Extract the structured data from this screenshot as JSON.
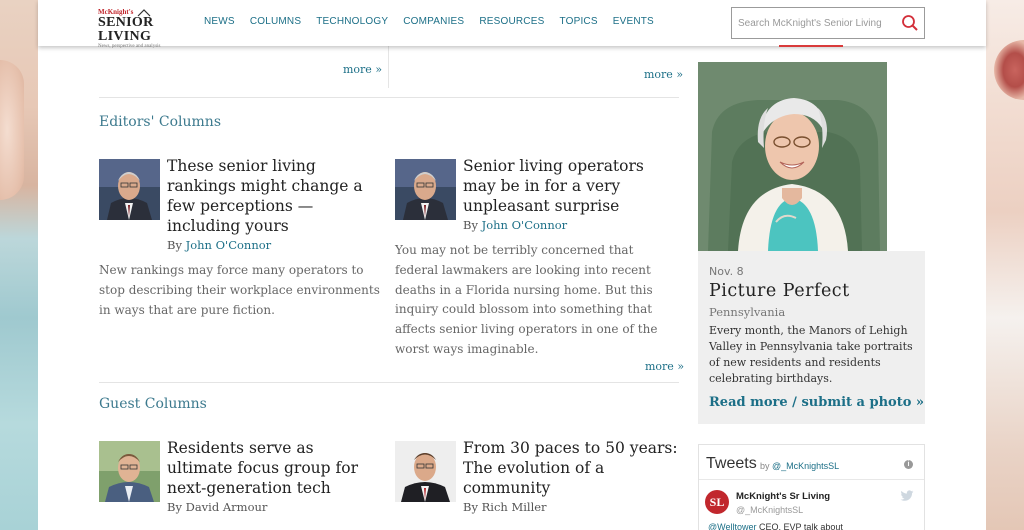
{
  "logo": {
    "line1": "McKnight's",
    "line2": "SENIOR LIVING",
    "tagline": "News, perspective and analysis"
  },
  "nav": [
    "NEWS",
    "COLUMNS",
    "TECHNOLOGY",
    "COMPANIES",
    "RESOURCES",
    "TOPICS",
    "EVENTS"
  ],
  "search": {
    "placeholder": "Search McKnight's Senior Living",
    "icon": "search-icon"
  },
  "top_more": {
    "left": "more »",
    "right": "more »"
  },
  "editors": {
    "title": "Editors' Columns",
    "articles": [
      {
        "title": "These senior living rankings might change a few perceptions — including yours",
        "by": "By ",
        "author": "John O'Connor",
        "excerpt": "New rankings may force many operators to stop describing their workplace environments in ways that are pure fiction."
      },
      {
        "title": "Senior living operators may be in for a very unpleasant surprise",
        "by": "By ",
        "author": "John O'Connor",
        "excerpt": "You may not be terribly concerned that federal lawmakers are looking into recent deaths in a Florida nursing home. But this inquiry could blossom into something that affects senior living operators in one of the worst ways imaginable."
      }
    ],
    "more": "more »"
  },
  "guest": {
    "title": "Guest Columns",
    "articles": [
      {
        "title": "Residents serve as ultimate focus group for next-generation tech",
        "by": "By David Armour"
      },
      {
        "title": "From 30 paces to 50 years: The evolution of a community",
        "by": "By Rich Miller"
      }
    ]
  },
  "picture_perfect": {
    "date": "Nov. 8",
    "title": "Picture Perfect",
    "location": "Pennsylvania",
    "description": "Every month, the Manors of Lehigh Valley in Pennsylvania take portraits of new residents and residents celebrating birthdays.",
    "link": "Read more / submit a photo »"
  },
  "tweets": {
    "heading": "Tweets",
    "by_prefix": "by ",
    "by_handle": "@_McKnightsSL",
    "info": "i",
    "account_name": "McKnight's Sr Living",
    "account_handle": "@_McKnightsSL",
    "avatar_text": "SL",
    "text_mention": "@Welltower",
    "text_rest": " CEO, EVP talk about"
  },
  "colors": {
    "accent": "#1c6f87",
    "brand_red": "#c1272d",
    "section_title": "#3d7a8e"
  }
}
